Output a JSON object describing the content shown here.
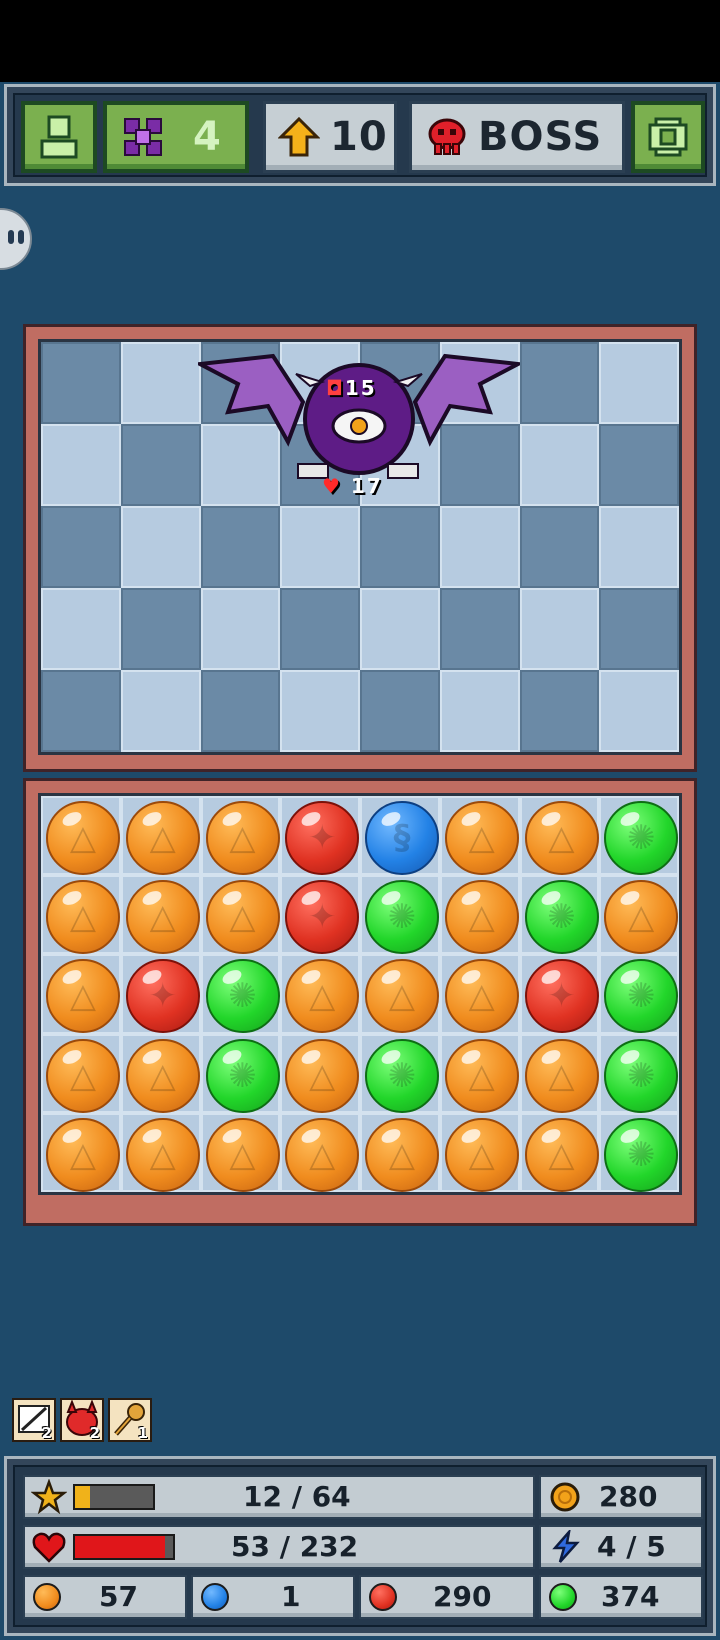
{
  "colors": {
    "background": "#1e4a6a",
    "panel": "#33465a",
    "green_button": "#7bb04f",
    "board_frame": "#c06d62",
    "orb_orange": "#f08c1e",
    "orb_red": "#e03222",
    "orb_green": "#22d62a",
    "orb_blue": "#2382e6",
    "xp_bar": "#f0b21a",
    "hp_bar": "#e0161a"
  },
  "topbar": {
    "profile_icon": "person-icon",
    "gems": "4",
    "gem_icon": "purple-flower-icon",
    "level": "10",
    "level_icon": "up-arrow-icon",
    "boss_label": "BOSS",
    "boss_icon": "red-skull-icon",
    "settings_icon": "gear-icon"
  },
  "enemy": {
    "name_icon": "purple-bat-demon",
    "attack": "15",
    "health": "17"
  },
  "arena": {
    "rows": 5,
    "cols": 8
  },
  "orb_grid": [
    [
      "orange",
      "orange",
      "orange",
      "red",
      "blue",
      "orange",
      "orange",
      "green"
    ],
    [
      "orange",
      "orange",
      "orange",
      "red",
      "green",
      "orange",
      "green",
      "orange"
    ],
    [
      "orange",
      "red",
      "green",
      "orange",
      "orange",
      "orange",
      "red",
      "green"
    ],
    [
      "orange",
      "orange",
      "green",
      "orange",
      "green",
      "orange",
      "orange",
      "green"
    ],
    [
      "orange",
      "orange",
      "orange",
      "orange",
      "orange",
      "orange",
      "orange",
      "green"
    ]
  ],
  "powerups": [
    {
      "icon": "dice-scroll-icon",
      "count": "2"
    },
    {
      "icon": "red-demon-icon",
      "count": "2"
    },
    {
      "icon": "key-icon",
      "count": "1"
    }
  ],
  "stats": {
    "xp": "12 / 64",
    "xp_fraction": 0.1875,
    "gold": "280",
    "hp": "53 / 232",
    "hp_fraction": 0.2284,
    "energy": "4 / 5",
    "orange_count": "57",
    "blue_count": "1",
    "red_count": "290",
    "green_count": "374"
  }
}
